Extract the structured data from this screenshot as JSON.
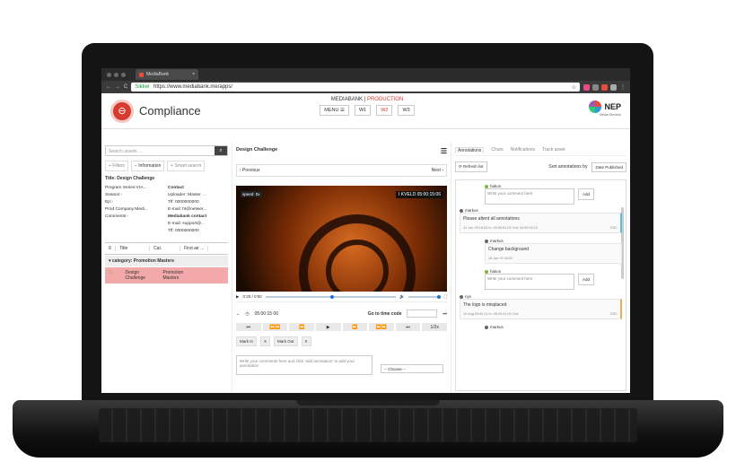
{
  "browser": {
    "tab_title": "MediaBank",
    "tab_close": "×",
    "back_glyph": "←",
    "forward_glyph": "→",
    "reload_glyph": "C",
    "secure_label": "Sikker",
    "url": "https://www.mediabank.me/apps/",
    "star_glyph": "☆",
    "menu_glyph": "⋮"
  },
  "header": {
    "app_title": "Compliance",
    "brand": "MEDIABANK",
    "brand_sep": " | ",
    "product": "PRODUCTION",
    "menu_label": "MENU ☰",
    "windows": [
      "W1",
      "W2",
      "W3"
    ],
    "active_window": "W2",
    "company_logo": "NEP",
    "company_sub": "Media Services"
  },
  "left": {
    "search_placeholder": "Search assets ...",
    "tabs": [
      "+ Filters",
      "− Information",
      "+ Smart search"
    ],
    "title": "Title: Design Challenge",
    "meta_left": [
      "Program Series:VIA...",
      "Season:-",
      "Ep:-",
      "Prod Company:Medi...",
      "Comments:-"
    ],
    "meta_right": [
      "Contact",
      "Uploader: Master ...",
      "Tlf: 0000000000",
      "E-mail: ht@netwer...",
      "Mediabank contact",
      "E-mail: support@...",
      "Tlf: 0000000000"
    ],
    "grid_cols": [
      "ß",
      "Title",
      "Cat.",
      "First air ..."
    ],
    "category_row": "category: Promotion Masters",
    "selected_title": "Design Challenge",
    "selected_cat": "Promotion Masters"
  },
  "player": {
    "title": "Design Challenge",
    "menu_glyph": "☰",
    "prev": "‹ Previous",
    "next": "Next ›",
    "speed": "speed: 0x",
    "overlay": "I KVELD 05:00:15:06",
    "time": "0:25 / 0:50",
    "timecode": "05:00:15 06",
    "goto_label": "Go to time code",
    "transport": [
      "⏮",
      "⏪⏪",
      "⏪",
      "▶",
      "⏩",
      "⏩⏩",
      "⏭",
      "1/2x"
    ],
    "mark_in": "Mark In",
    "mark_out": "Mark Out",
    "x": "X",
    "comment_placeholder": "Write your comments here and click 'add annotation' to add your annotation",
    "choose": "-- Choose --",
    "progress": 0.5
  },
  "annotations": {
    "tabs": [
      "Annotations",
      "Chars",
      "Notifications",
      "Track asset"
    ],
    "refresh": "⟳ Refresh list",
    "sort_label": "Sort annotations by",
    "sort_value": "Date Published",
    "items": [
      {
        "user": "hakon",
        "kind": "reply",
        "placeholder": "Write your comment here",
        "add": "Add"
      },
      {
        "user": "markus",
        "kind": "note",
        "text": "Please attent all annotations",
        "sub": "12 Jan 09:16:53    In: 04:59:51:02 Out: 04:59:53:10",
        "code": "ESC"
      },
      {
        "user": "markus",
        "kind": "reply-card",
        "text": "Change background",
        "sub": "16 Jan 07:44:52"
      },
      {
        "user": "hakon",
        "kind": "reply",
        "placeholder": "Write your comment here",
        "add": "Add"
      },
      {
        "user": "nyx",
        "kind": "note",
        "text": "The logo is misplaced",
        "sub": "10 Aug 09:52:11   In: 05:00:01:00 Out:",
        "code": "ESC"
      },
      {
        "user": "markus",
        "kind": "user-only"
      }
    ]
  }
}
